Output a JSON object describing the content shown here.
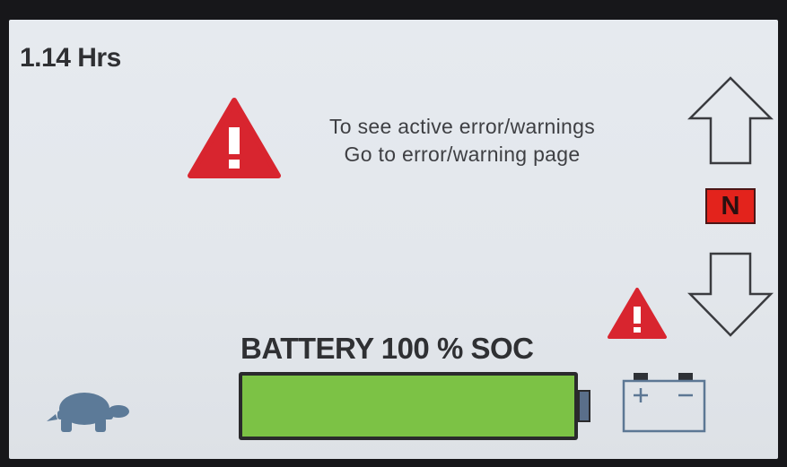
{
  "header": {
    "hours": "1.14 Hrs"
  },
  "message": {
    "line1": "To see active error/warnings",
    "line2": "Go to error/warning page"
  },
  "gear": {
    "label": "N"
  },
  "battery": {
    "label": "BATTERY 100 % SOC",
    "charge_fraction": 1.0,
    "fill_color": "#7cc245"
  },
  "icons": {
    "main_warning": "warning-triangle-icon",
    "small_warning": "warning-triangle-icon",
    "up": "arrow-up-icon",
    "down": "arrow-down-icon",
    "battery": "battery-terminal-icon",
    "speed_mode": "turtle-icon"
  },
  "colors": {
    "warning_red": "#d8252f",
    "gear_red": "#e3231c",
    "screen_bg": "#e4e8ed"
  }
}
